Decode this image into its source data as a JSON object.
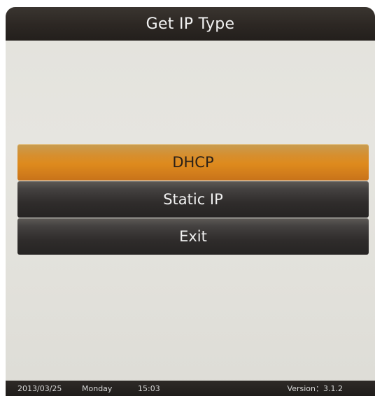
{
  "window": {
    "title": "Get IP Type"
  },
  "menu": {
    "items": [
      {
        "label": "DHCP",
        "selected": true
      },
      {
        "label": "Static IP",
        "selected": false
      },
      {
        "label": "Exit",
        "selected": false
      }
    ]
  },
  "status": {
    "date": "2013/03/25",
    "day": "Monday",
    "time": "15:03",
    "version": "Version：3.1.2"
  },
  "colors": {
    "selected": "#de8a1d",
    "item": "#2f2c2b",
    "background": "#e3e2dc"
  }
}
